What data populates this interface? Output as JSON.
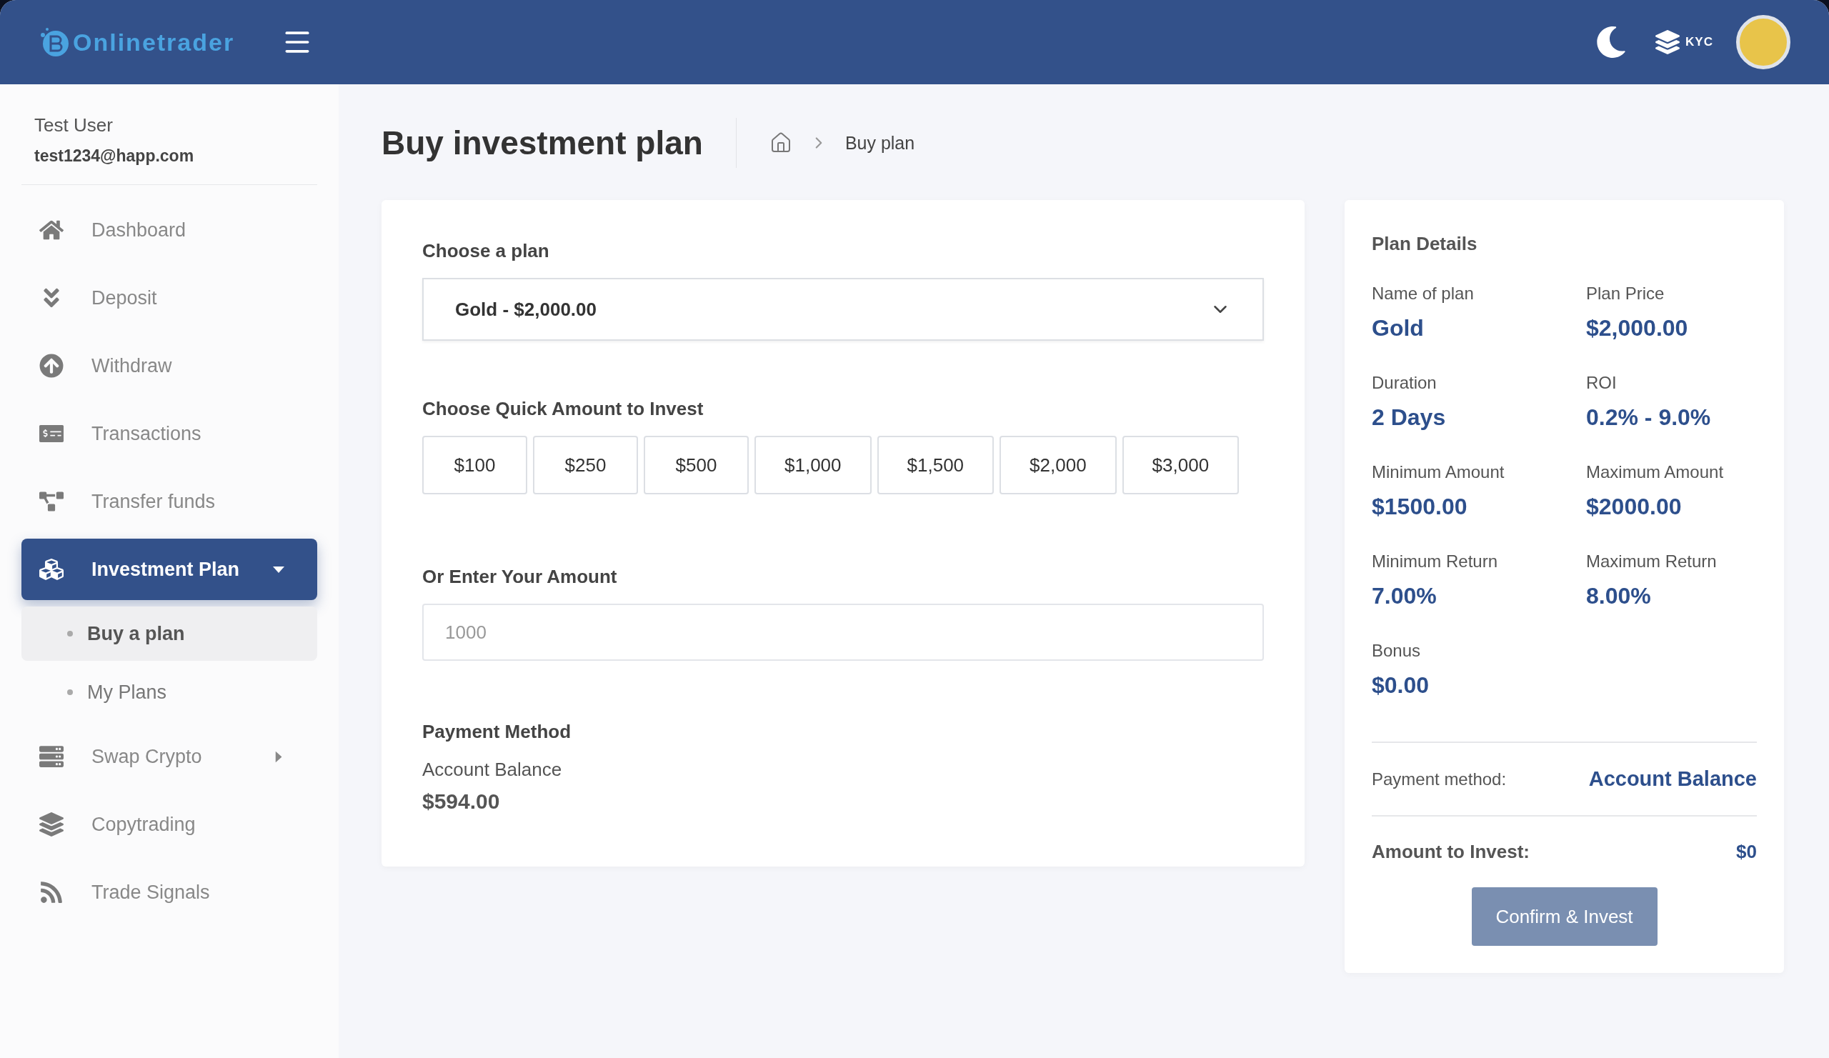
{
  "header": {
    "logo_text": "Onlinetrader",
    "kyc_label": "KYC"
  },
  "user": {
    "name": "Test User",
    "email": "test1234@happ.com"
  },
  "sidebar": {
    "items": [
      {
        "label": "Dashboard",
        "selected": false
      },
      {
        "label": "Deposit",
        "selected": false
      },
      {
        "label": "Withdraw",
        "selected": false
      },
      {
        "label": "Transactions",
        "selected": false
      },
      {
        "label": "Transfer funds",
        "selected": false
      },
      {
        "label": "Investment Plan",
        "selected": true,
        "expanded": true,
        "children": [
          {
            "label": "Buy a plan",
            "selected": true
          },
          {
            "label": "My Plans",
            "selected": false
          }
        ]
      },
      {
        "label": "Swap Crypto",
        "selected": false,
        "expanded": false
      },
      {
        "label": "Copytrading",
        "selected": false
      },
      {
        "label": "Trade Signals",
        "selected": false
      }
    ]
  },
  "page": {
    "title": "Buy investment plan",
    "breadcrumb": "Buy plan"
  },
  "form": {
    "plan_label": "Choose a plan",
    "plan_value": "Gold - $2,000.00",
    "quick_label": "Choose Quick Amount to Invest",
    "quick_amounts": [
      "$100",
      "$250",
      "$500",
      "$1,000",
      "$1,500",
      "$2,000",
      "$3,000"
    ],
    "amount_label": "Or Enter Your Amount",
    "amount_placeholder": "1000",
    "payment_label": "Payment Method",
    "payment_name": "Account Balance",
    "payment_balance": "$594.00"
  },
  "details": {
    "title": "Plan Details",
    "fields": [
      {
        "label": "Name of plan",
        "value": "Gold"
      },
      {
        "label": "Plan Price",
        "value": "$2,000.00"
      },
      {
        "label": "Duration",
        "value": "2 Days"
      },
      {
        "label": "ROI",
        "value": "0.2% - 9.0%"
      },
      {
        "label": "Minimum Amount",
        "value": "$1500.00"
      },
      {
        "label": "Maximum Amount",
        "value": "$2000.00"
      },
      {
        "label": "Minimum Return",
        "value": "7.00%"
      },
      {
        "label": "Maximum Return",
        "value": "8.00%"
      },
      {
        "label": "Bonus",
        "value": "$0.00"
      }
    ],
    "payment_label": "Payment method:",
    "payment_value": "Account Balance",
    "amount_label": "Amount to Invest:",
    "amount_value": "$0",
    "confirm": {
      "label": "Confirm & Invest",
      "disabled": true
    }
  }
}
